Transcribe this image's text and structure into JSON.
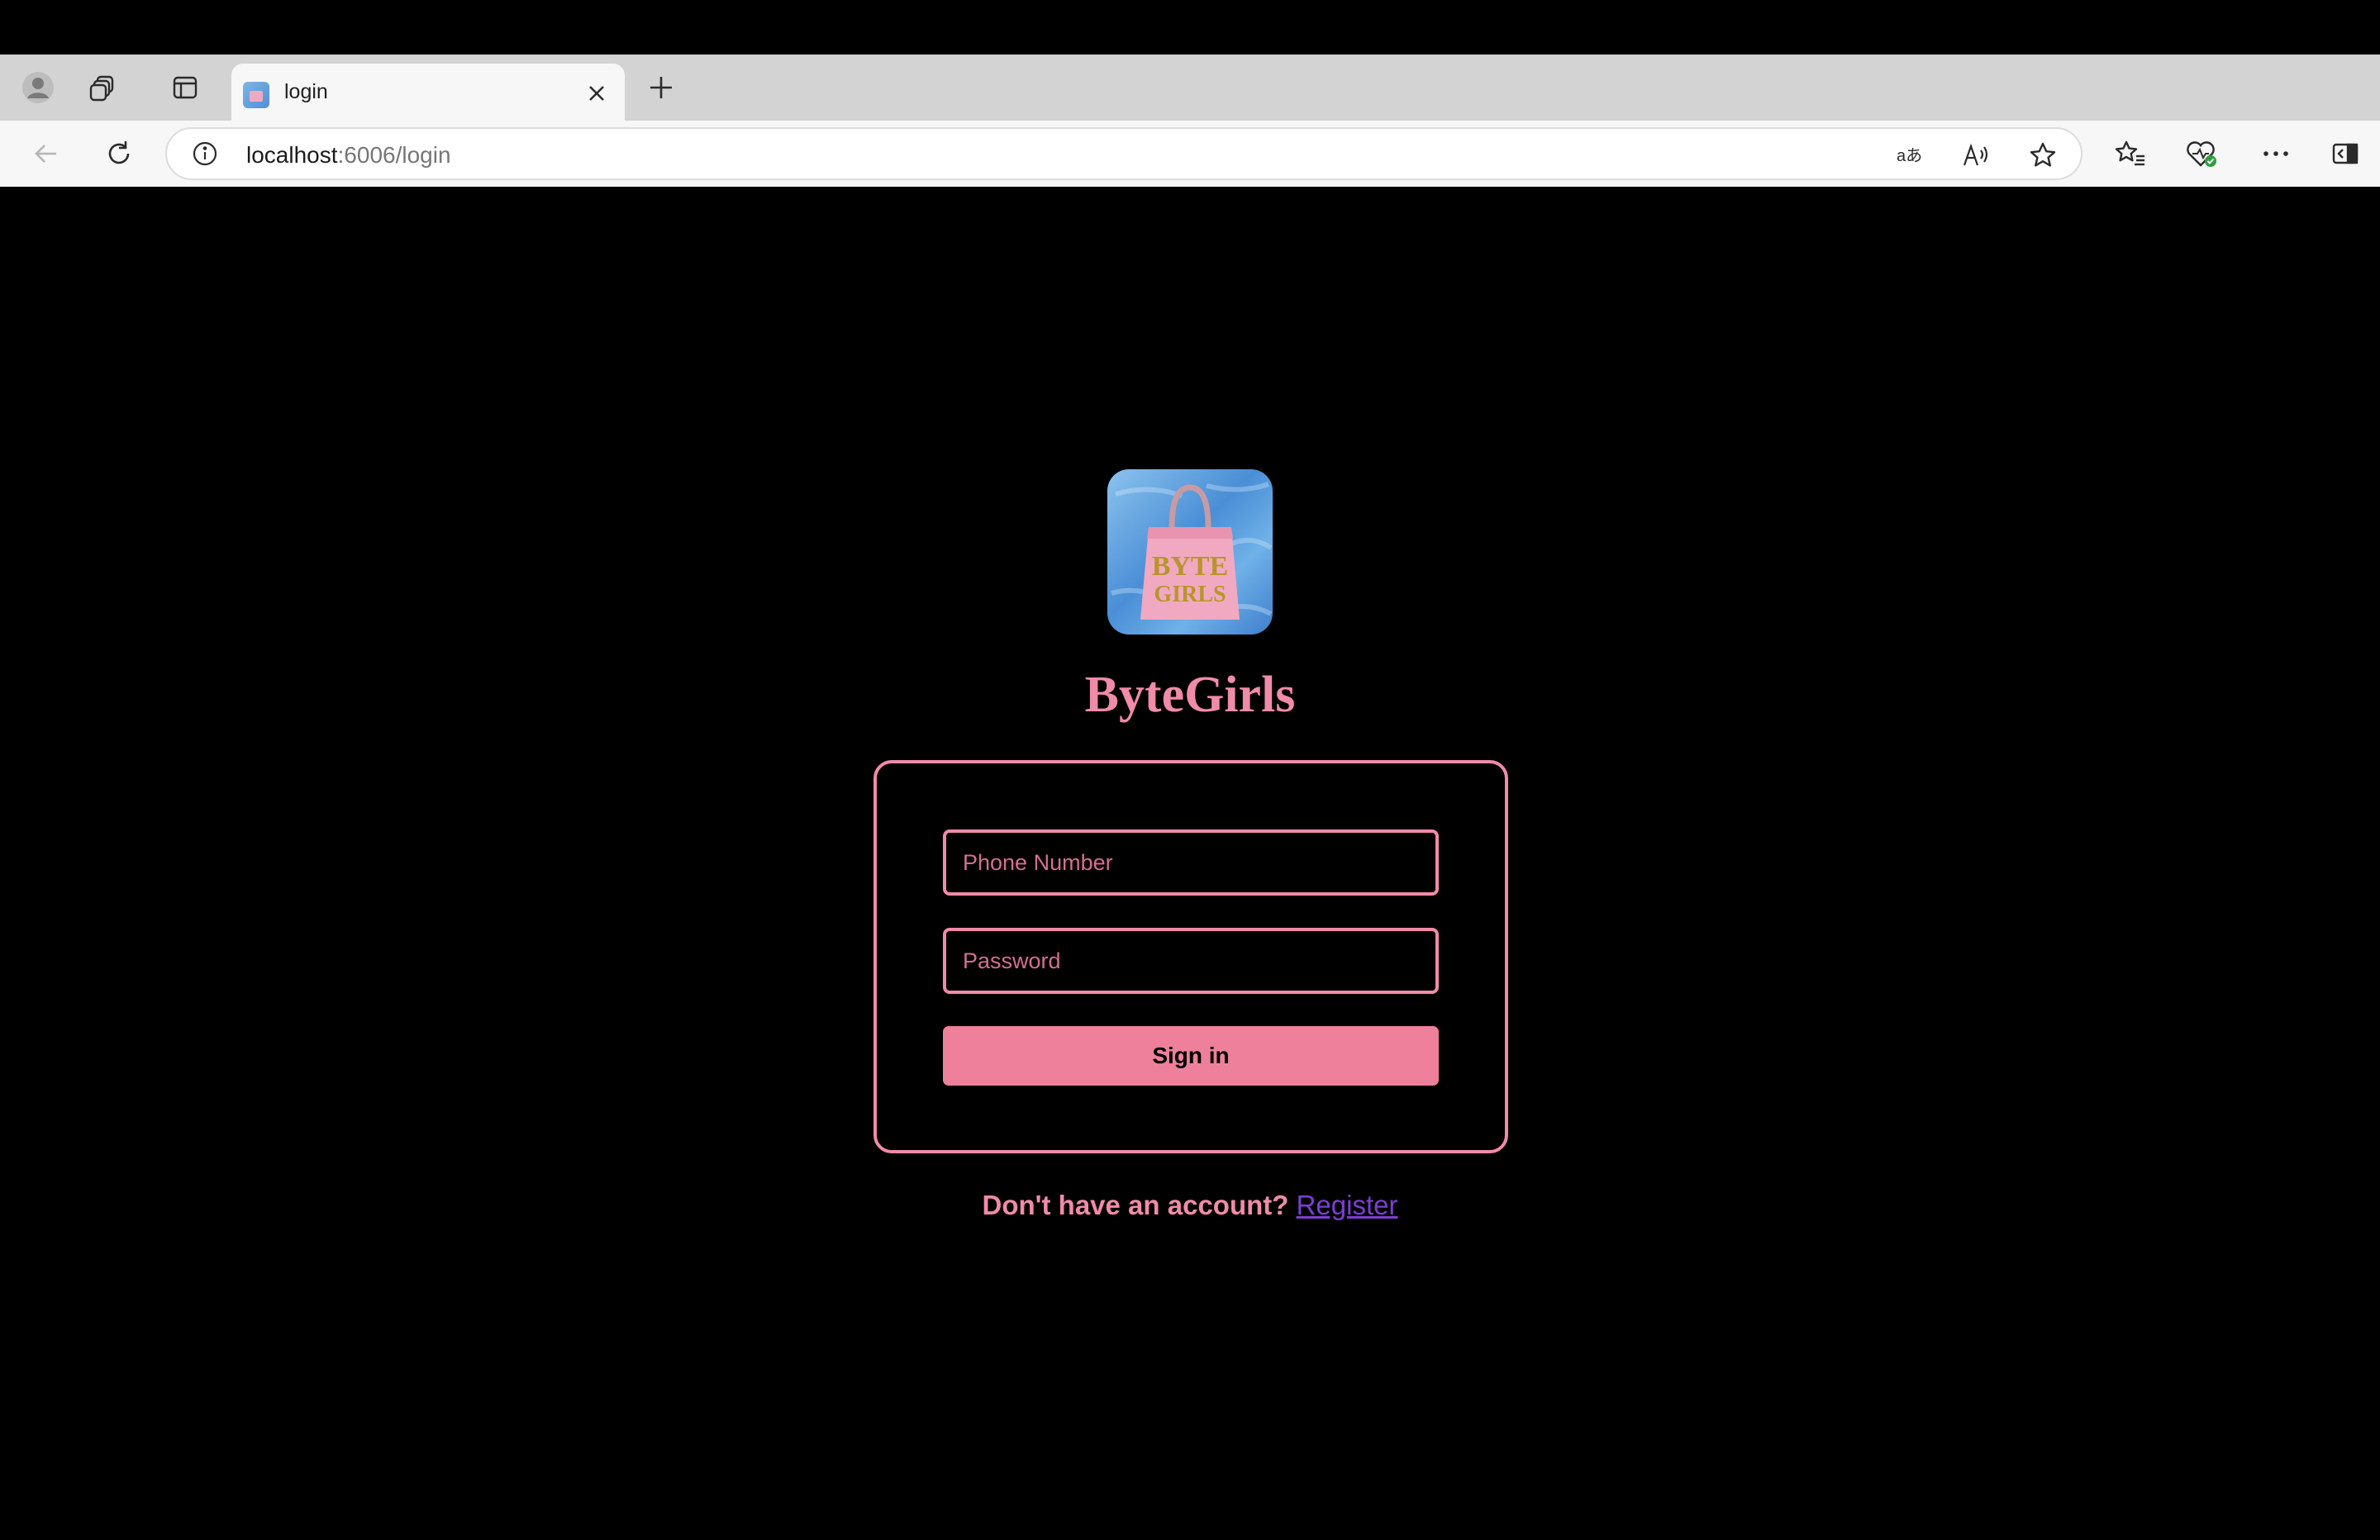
{
  "browser": {
    "tab": {
      "title": "login"
    },
    "address": {
      "host": "localhost",
      "path": ":6006/login"
    },
    "colors": {
      "tabstrip": "#d3d3d3",
      "toolbar": "#f7f7f7"
    },
    "icons": [
      "profile-icon",
      "collections-icon",
      "vertical-tabs-icon",
      "close-icon",
      "new-tab-icon",
      "back-icon",
      "refresh-icon",
      "site-info-icon",
      "translate-icon",
      "read-aloud-icon",
      "favorite-star-icon",
      "favorites-list-icon",
      "browser-essentials-icon",
      "more-icon",
      "sidebar-icon"
    ]
  },
  "page": {
    "logo": {
      "line1": "BYTE",
      "line2": "GIRLS"
    },
    "title": "ByteGirls",
    "form": {
      "phone_placeholder": "Phone Number",
      "password_placeholder": "Password",
      "submit_label": "Sign in"
    },
    "register_prompt": "Don't have an account?",
    "register_link": "Register",
    "colors": {
      "accent": "#f08ba8",
      "button": "#ee809c",
      "link": "#7b3fd0",
      "background": "#000000"
    }
  }
}
